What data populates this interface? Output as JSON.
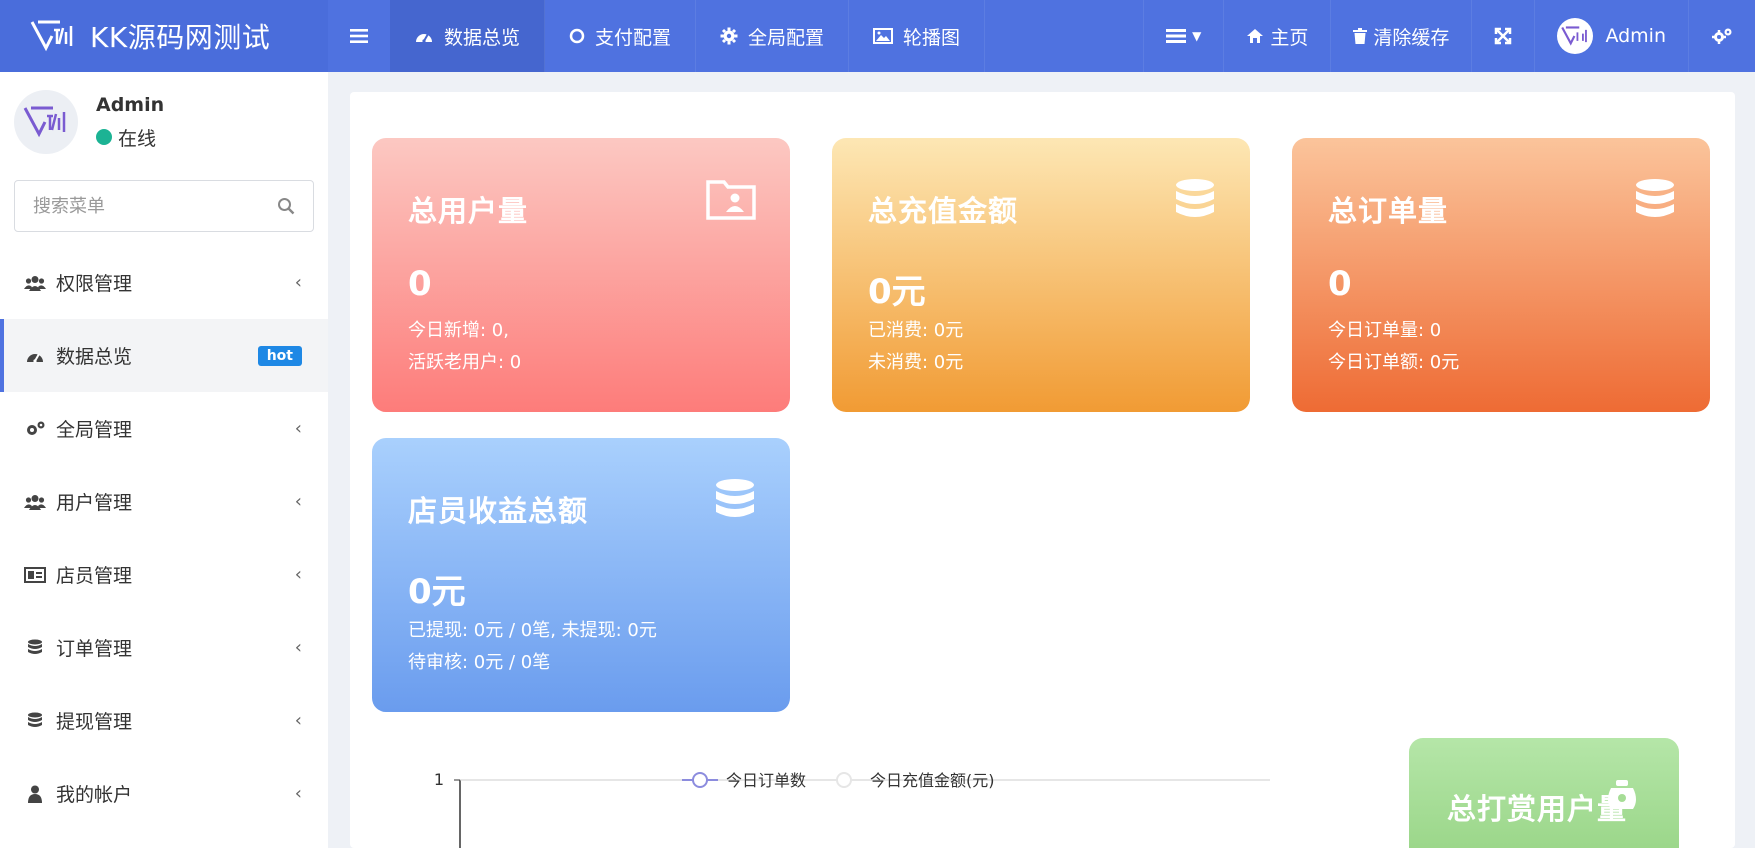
{
  "app": {
    "title": "KK源码网测试",
    "logo_icon": "brand-logo-icon"
  },
  "topnav": {
    "items": [
      {
        "label": "数据总览",
        "icon": "dashboard-icon"
      },
      {
        "label": "支付配置",
        "icon": "circle-icon"
      },
      {
        "label": "全局配置",
        "icon": "gear-icon"
      },
      {
        "label": "轮播图",
        "icon": "image-icon"
      }
    ],
    "right": {
      "home_label": "主页",
      "clear_cache_label": "清除缓存",
      "user_label": "Admin"
    }
  },
  "sidebar": {
    "user": {
      "name": "Admin",
      "status": "在线"
    },
    "search": {
      "placeholder": "搜索菜单"
    },
    "items": [
      {
        "label": "权限管理",
        "icon": "users-icon"
      },
      {
        "label": "数据总览",
        "icon": "dashboard-icon",
        "badge": "hot"
      },
      {
        "label": "全局管理",
        "icon": "gears-icon"
      },
      {
        "label": "用户管理",
        "icon": "users-icon"
      },
      {
        "label": "店员管理",
        "icon": "id-card-icon"
      },
      {
        "label": "订单管理",
        "icon": "database-icon"
      },
      {
        "label": "提现管理",
        "icon": "database-icon"
      },
      {
        "label": "我的帐户",
        "icon": "user-icon"
      }
    ]
  },
  "cards": {
    "users": {
      "title": "总用户量",
      "value": "0",
      "line1": "今日新增: 0,",
      "line2": "活跃老用户: 0"
    },
    "recharge": {
      "title": "总充值金额",
      "value": "0元",
      "line1": "已消费: 0元",
      "line2": "未消费: 0元"
    },
    "orders": {
      "title": "总订单量",
      "value": "0",
      "line1": "今日订单量: 0",
      "line2": "今日订单额: 0元"
    },
    "staff": {
      "title": "店员收益总额",
      "value": "0元",
      "line1": "已提现: 0元 / 0笔, 未提现: 0元",
      "line2": "待审核: 0元 / 0笔"
    },
    "tips": {
      "title": "总打赏用户量"
    }
  },
  "chart_data": {
    "type": "line",
    "series": [
      {
        "name": "今日订单数",
        "values": []
      },
      {
        "name": "今日充值金额(元)",
        "values": []
      }
    ],
    "yticks": [
      "1"
    ],
    "legend": "top-center"
  }
}
